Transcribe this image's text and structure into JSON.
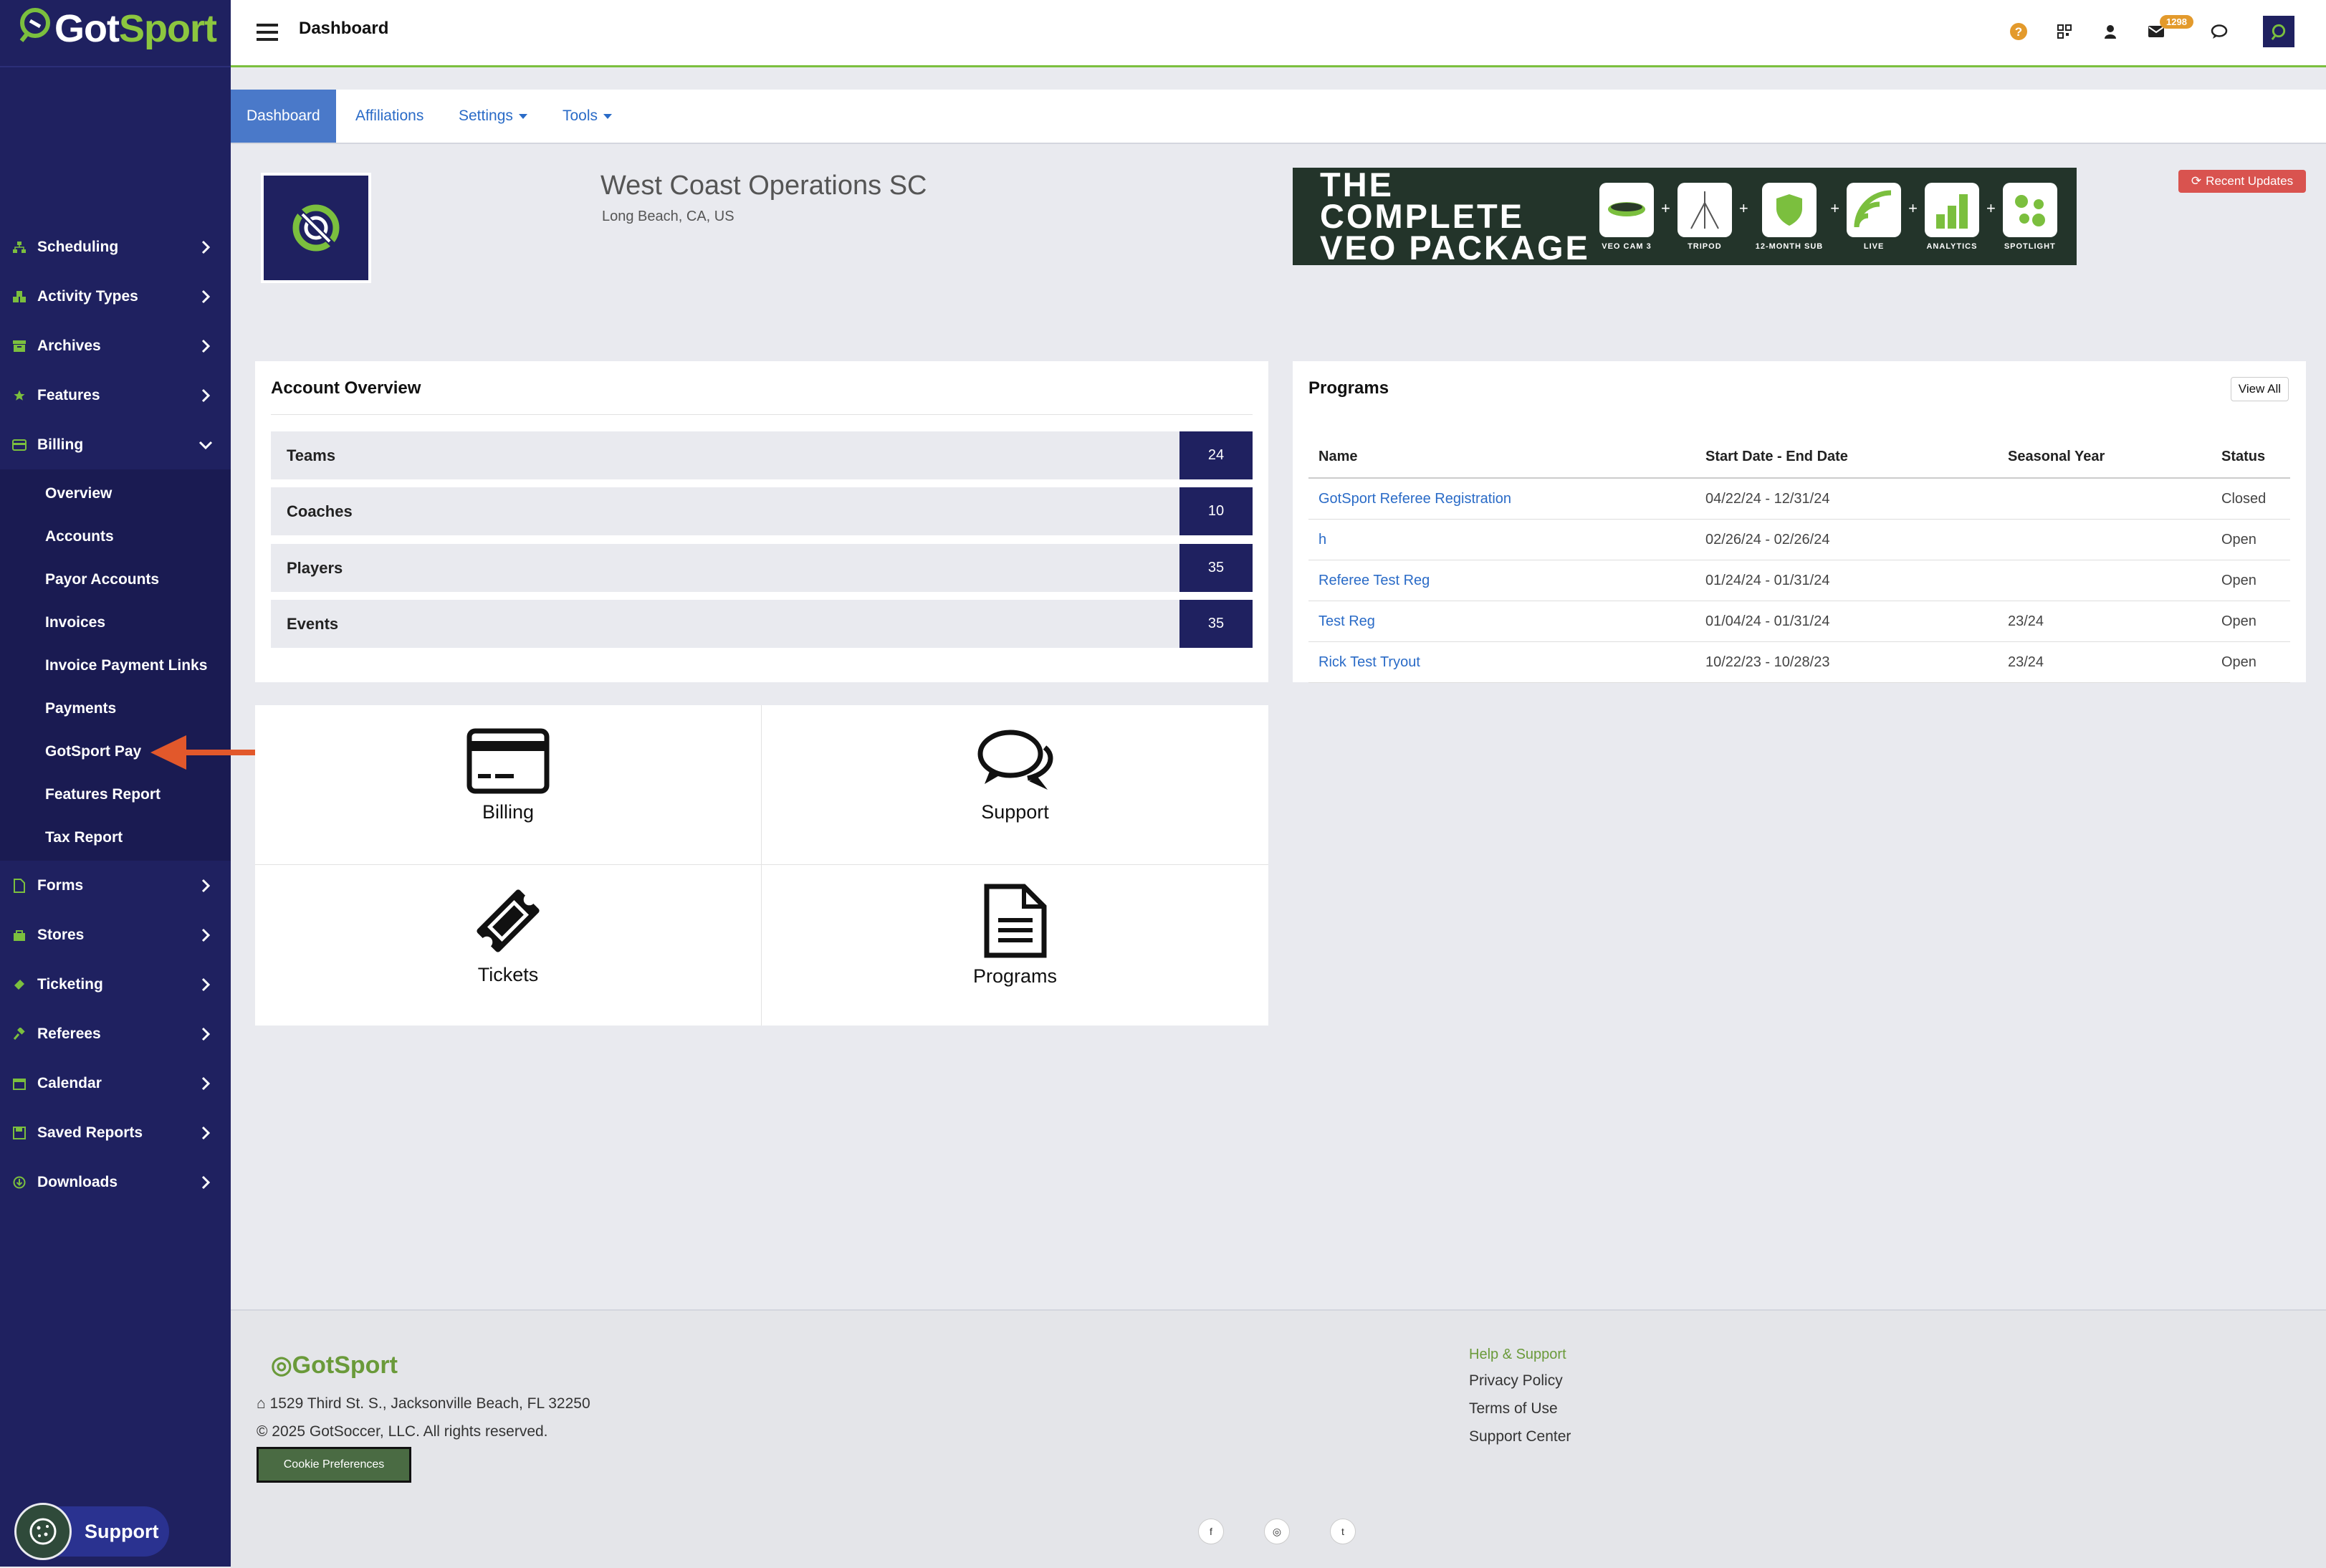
{
  "brand": {
    "logo_g": "Got",
    "logo_sport": "Sport"
  },
  "header": {
    "title": "Dashboard",
    "mail_count": "1298"
  },
  "sidebar": {
    "items_top": [
      {
        "label": "Scheduling",
        "icon": "sitemap-icon"
      },
      {
        "label": "Activity Types",
        "icon": "cubes-icon"
      },
      {
        "label": "Archives",
        "icon": "archive-icon"
      },
      {
        "label": "Features",
        "icon": "star-icon"
      },
      {
        "label": "Billing",
        "icon": "credit-card-icon"
      }
    ],
    "billing_sub": [
      "Overview",
      "Accounts",
      "Payor Accounts",
      "Invoices",
      "Invoice Payment Links",
      "Payments",
      "GotSport Pay",
      "Features Report",
      "Tax Report"
    ],
    "items_bottom": [
      {
        "label": "Forms",
        "icon": "file-icon"
      },
      {
        "label": "Stores",
        "icon": "shopping-bag-icon"
      },
      {
        "label": "Ticketing",
        "icon": "ticket-icon"
      },
      {
        "label": "Referees",
        "icon": "gavel-icon"
      },
      {
        "label": "Calendar",
        "icon": "calendar-icon"
      },
      {
        "label": "Saved Reports",
        "icon": "save-icon"
      },
      {
        "label": "Downloads",
        "icon": "download-icon"
      }
    ],
    "support_label": "Support"
  },
  "tabs": [
    {
      "label": "Dashboard"
    },
    {
      "label": "Affiliations"
    },
    {
      "label": "Settings"
    },
    {
      "label": "Tools"
    }
  ],
  "club": {
    "name": "West Coast Operations SC",
    "location": "Long Beach, CA, US"
  },
  "banner": {
    "title_line1": "THE COMPLETE",
    "title_line2": "VEO PACKAGE",
    "items": [
      "VEO CAM 3",
      "TRIPOD",
      "12-MONTH SUB",
      "LIVE",
      "ANALYTICS",
      "SPOTLIGHT"
    ]
  },
  "recent_updates": "Recent Updates",
  "account_overview": {
    "title": "Account Overview",
    "rows": [
      {
        "label": "Teams",
        "value": "24"
      },
      {
        "label": "Coaches",
        "value": "10"
      },
      {
        "label": "Players",
        "value": "35"
      },
      {
        "label": "Events",
        "value": "35"
      }
    ]
  },
  "programs": {
    "title": "Programs",
    "view_all": "View All",
    "columns": [
      "Name",
      "Start Date - End Date",
      "Seasonal Year",
      "Status"
    ],
    "rows": [
      {
        "name": "GotSport Referee Registration",
        "dates": "04/22/24 - 12/31/24",
        "year": "",
        "status": "Closed"
      },
      {
        "name": "h",
        "dates": "02/26/24 - 02/26/24",
        "year": "",
        "status": "Open"
      },
      {
        "name": "Referee Test Reg",
        "dates": "01/24/24 - 01/31/24",
        "year": "",
        "status": "Open"
      },
      {
        "name": "Test Reg",
        "dates": "01/04/24 - 01/31/24",
        "year": "23/24",
        "status": "Open"
      },
      {
        "name": "Rick Test Tryout",
        "dates": "10/22/23 - 10/28/23",
        "year": "23/24",
        "status": "Open"
      }
    ]
  },
  "tiles": [
    {
      "label": "Billing",
      "icon": "credit-card-icon"
    },
    {
      "label": "Support",
      "icon": "comments-icon"
    },
    {
      "label": "Tickets",
      "icon": "ticket-icon"
    },
    {
      "label": "Programs",
      "icon": "document-icon"
    }
  ],
  "footer": {
    "logo_got": "Got",
    "logo_sport": "Sport",
    "address": "1529 Third St. S., Jacksonville Beach, FL 32250",
    "copyright": "© 2025 GotSoccer, LLC. All rights reserved.",
    "cookie_btn": "Cookie Preferences",
    "links": [
      "Help & Support",
      "Privacy Policy",
      "Terms of Use",
      "Support Center"
    ],
    "socials": [
      "f",
      "◎",
      "t"
    ]
  },
  "colors": {
    "sidebar": "#1f2160",
    "accent_green": "#7bbf3e",
    "link_blue": "#2a6bc7",
    "arrow": "#e2582b",
    "danger": "#d9534f"
  }
}
